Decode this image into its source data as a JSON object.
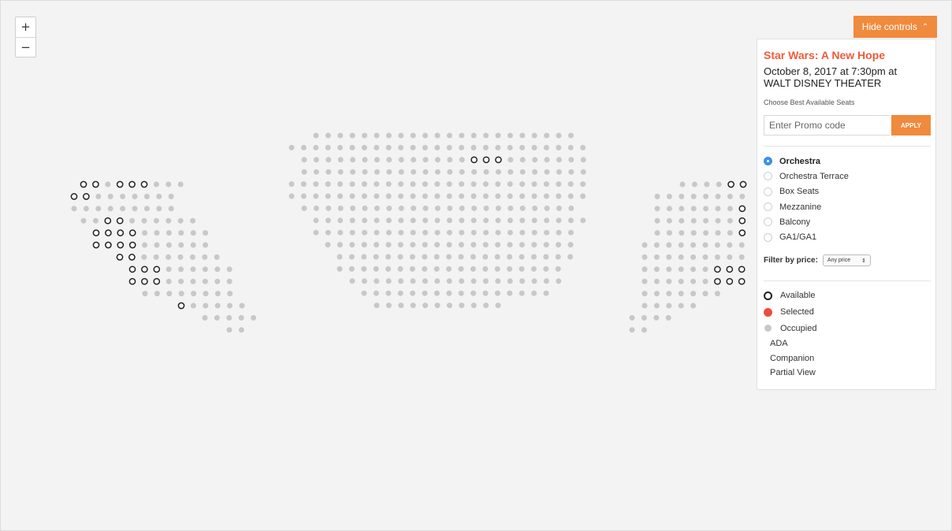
{
  "zoom": {
    "in_label": "+",
    "out_label": "−"
  },
  "controls": {
    "hide_label": "Hide controls",
    "chevron": "chevron-up-icon"
  },
  "event": {
    "title": "Star Wars: A New Hope",
    "date_venue": "October 8, 2017 at 7:30pm at  WALT DISNEY THEATER"
  },
  "best_seats_label": "Choose Best Available Seats",
  "promo": {
    "placeholder": "Enter Promo code",
    "value": "",
    "apply_label": "APPLY"
  },
  "sections": [
    {
      "label": "Orchestra",
      "selected": true
    },
    {
      "label": "Orchestra Terrace",
      "selected": false
    },
    {
      "label": "Box Seats",
      "selected": false
    },
    {
      "label": "Mezzanine",
      "selected": false
    },
    {
      "label": "Balcony",
      "selected": false
    },
    {
      "label": "GA1/GA1",
      "selected": false
    }
  ],
  "price_filter": {
    "label": "Filter by price:",
    "value": "Any price"
  },
  "legend": {
    "available": "Available",
    "selected": "Selected",
    "occupied": "Occupied",
    "ada": "ADA",
    "companion": "Companion",
    "partial_view": "Partial View"
  },
  "colors": {
    "accent": "#f08a3d",
    "title": "#f05a3a",
    "radio_selected": "#3d8ef0",
    "seat_occupied": "#c8c8c8",
    "seat_available_border": "#222222",
    "seat_selected": "#ee4b3a",
    "background": "#f3f3f3"
  },
  "seat_map": {
    "left_section": {
      "rows": [
        {
          "seats": "AA.AAA..."
        },
        {
          "seats": "AA......."
        },
        {
          "seats": "........."
        },
        {
          "seats": "..AA......"
        },
        {
          "seats": "AAAA......"
        },
        {
          "seats": "AAAA......"
        },
        {
          "seats": "AA......."
        },
        {
          "seats": "AAA......"
        },
        {
          "seats": "AAA......"
        },
        {
          "seats": "........"
        },
        {
          "seats": "A....."
        },
        {
          "seats": "....."
        },
        {
          "seats": ".."
        }
      ]
    },
    "center_section": {
      "rows": [
        {
          "seats": "......................"
        },
        {
          "seats": "........................."
        },
        {
          "seats": "..............AAA......."
        },
        {
          "seats": "........................"
        },
        {
          "seats": "........................."
        },
        {
          "seats": "........................."
        },
        {
          "seats": "......................."
        },
        {
          "seats": "......................."
        },
        {
          "seats": "......................"
        },
        {
          "seats": "....................."
        },
        {
          "seats": "...................."
        },
        {
          "seats": "..................."
        },
        {
          "seats": ".................."
        },
        {
          "seats": "................"
        },
        {
          "seats": "..........."
        }
      ]
    },
    "right_section": {
      "rows": [
        {
          "seats": "....AAA"
        },
        {
          "seats": ".........A"
        },
        {
          "seats": ".......AAA"
        },
        {
          "seats": ".......AAA"
        },
        {
          "seats": ".......AAA"
        },
        {
          "seats": ".........."
        },
        {
          "seats": "........."
        },
        {
          "seats": "......AAA"
        },
        {
          "seats": "......AAA"
        },
        {
          "seats": "......."
        },
        {
          "seats": "....."
        },
        {
          "seats": "...."
        },
        {
          "seats": ".."
        }
      ]
    }
  }
}
